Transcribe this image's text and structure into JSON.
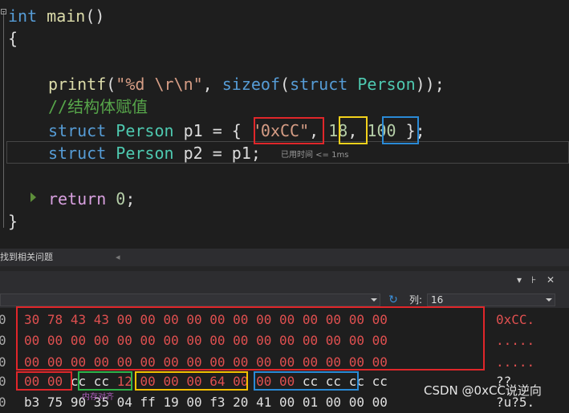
{
  "code": {
    "lines": [
      {
        "tokens": [
          [
            "kw",
            "int"
          ],
          [
            "pun",
            " "
          ],
          [
            "fn",
            "main"
          ],
          [
            "pun",
            "()"
          ]
        ]
      },
      {
        "tokens": [
          [
            "pun",
            "{"
          ]
        ]
      },
      {
        "tokens": []
      },
      {
        "tokens": [
          [
            "fn",
            "printf"
          ],
          [
            "pun",
            "("
          ],
          [
            "str",
            "\"%d \\r\\n\""
          ],
          [
            "pun",
            ", "
          ],
          [
            "kw",
            "sizeof"
          ],
          [
            "pun",
            "("
          ],
          [
            "kw",
            "struct"
          ],
          [
            "pun",
            " "
          ],
          [
            "ty",
            "Person"
          ],
          [
            "pun",
            "));"
          ]
        ]
      },
      {
        "tokens": [
          [
            "cm",
            "//结构体赋值"
          ]
        ]
      },
      {
        "tokens": [
          [
            "kw",
            "struct"
          ],
          [
            "pun",
            " "
          ],
          [
            "ty",
            "Person"
          ],
          [
            "pun",
            " p1 = { "
          ],
          [
            "str",
            "\"0xCC\""
          ],
          [
            "pun",
            ", "
          ],
          [
            "num",
            "18"
          ],
          [
            "pun",
            ", "
          ],
          [
            "num",
            "100"
          ],
          [
            "pun",
            " };"
          ]
        ]
      },
      {
        "tokens": [
          [
            "kw",
            "struct"
          ],
          [
            "pun",
            " "
          ],
          [
            "ty",
            "Person"
          ],
          [
            "pun",
            " p2 = p1;"
          ]
        ]
      },
      {
        "tokens": []
      },
      {
        "tokens": [
          [
            "ctl",
            "return"
          ],
          [
            "pun",
            " "
          ],
          [
            "num",
            "0"
          ],
          [
            "pun",
            ";"
          ]
        ]
      },
      {
        "tokens": [
          [
            "pun",
            "}"
          ]
        ]
      }
    ],
    "elapsed_hint": "已用时间 <= 1ms"
  },
  "panel": {
    "title": "找到相关问题"
  },
  "memory": {
    "header_buttons": [
      "▾",
      "⊦",
      "✕"
    ],
    "column_label": "列:",
    "column_value": "16",
    "rows": [
      {
        "addr": "0",
        "bytes": [
          "30",
          "78",
          "43",
          "43",
          "00",
          "00",
          "00",
          "00",
          "00",
          "00",
          "00",
          "00",
          "00",
          "00",
          "00",
          "00"
        ],
        "ascii": "0xCC."
      },
      {
        "addr": "0",
        "bytes": [
          "00",
          "00",
          "00",
          "00",
          "00",
          "00",
          "00",
          "00",
          "00",
          "00",
          "00",
          "00",
          "00",
          "00",
          "00",
          "00"
        ],
        "ascii": "....."
      },
      {
        "addr": "0",
        "bytes": [
          "00",
          "00",
          "00",
          "00",
          "00",
          "00",
          "00",
          "00",
          "00",
          "00",
          "00",
          "00",
          "00",
          "00",
          "00",
          "00"
        ],
        "ascii": "....."
      },
      {
        "addr": "0",
        "bytes": [
          "00",
          "00",
          "cc",
          "cc",
          "12",
          "00",
          "00",
          "00",
          "64",
          "00",
          "00",
          "00",
          "cc",
          "cc",
          "cc",
          "cc"
        ],
        "ascii": "??"
      },
      {
        "addr": "0",
        "bytes": [
          "b3",
          "75",
          "90",
          "35",
          "04",
          "ff",
          "19",
          "00",
          "f3",
          "20",
          "41",
          "00",
          "01",
          "00",
          "00",
          "00"
        ],
        "ascii": "?u?5."
      }
    ]
  },
  "watermark": "CSDN @0xCC说逆向",
  "watermark2": "内存对齐",
  "colors": {
    "box_red": "#e0262a",
    "box_yellow": "#f3d21c",
    "box_blue": "#2a8ad6",
    "box_green": "#2fb24a",
    "box_orange": "#f5c000"
  }
}
